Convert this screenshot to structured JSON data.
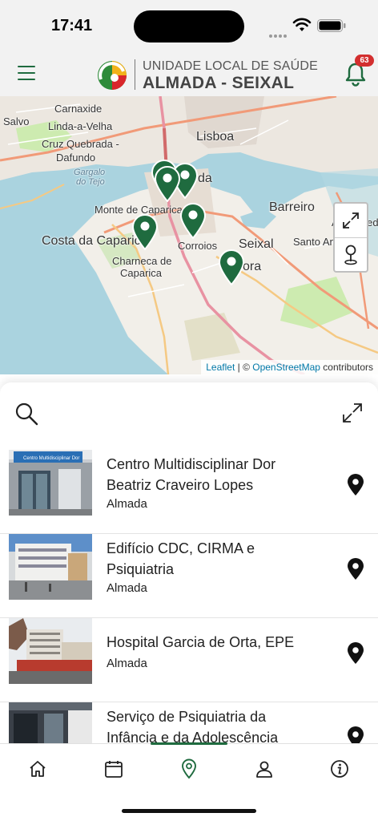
{
  "status_bar": {
    "time": "17:41"
  },
  "header": {
    "brand_line1": "UNIDADE LOCAL DE SAÚDE",
    "brand_line2": "ALMADA - SEIXAL",
    "notifications_count": "63"
  },
  "map": {
    "places": [
      "Carnaxide",
      "Salvo",
      "Linda-a-Velha",
      "Cruz Quebrada -",
      "Dafundo",
      "Gargalo",
      "do Tejo",
      "Lisboa",
      "da",
      "Monte de Caparica",
      "Costa da Caparica",
      "Charneca de",
      "Caparica",
      "Corroios",
      "Seixal",
      "ora",
      "Barreiro",
      "Alhos Vedr",
      "Santo André"
    ],
    "attribution_leaflet": "Leaflet",
    "attribution_sep": " | © ",
    "attribution_osm": "OpenStreetMap",
    "attribution_tail": " contributors"
  },
  "locations": [
    {
      "title": "Centro Multidisciplinar Dor Beatriz Craveiro Lopes",
      "city": "Almada",
      "sign": "Centro Multidisciplinar Dor"
    },
    {
      "title": "Edifício CDC, CIRMA e Psiquiatria",
      "city": "Almada"
    },
    {
      "title": "Hospital Garcia de Orta, EPE",
      "city": "Almada"
    },
    {
      "title": "Serviço de Psiquiatria da Infância e da Adolescência",
      "city": ""
    }
  ],
  "colors": {
    "brand_green": "#1f6b3f",
    "badge_red": "#d32f2f",
    "water": "#aad3df",
    "land": "#f2efe9"
  },
  "tabs": [
    "home",
    "calendar",
    "locations",
    "profile",
    "info"
  ],
  "active_tab": "locations"
}
